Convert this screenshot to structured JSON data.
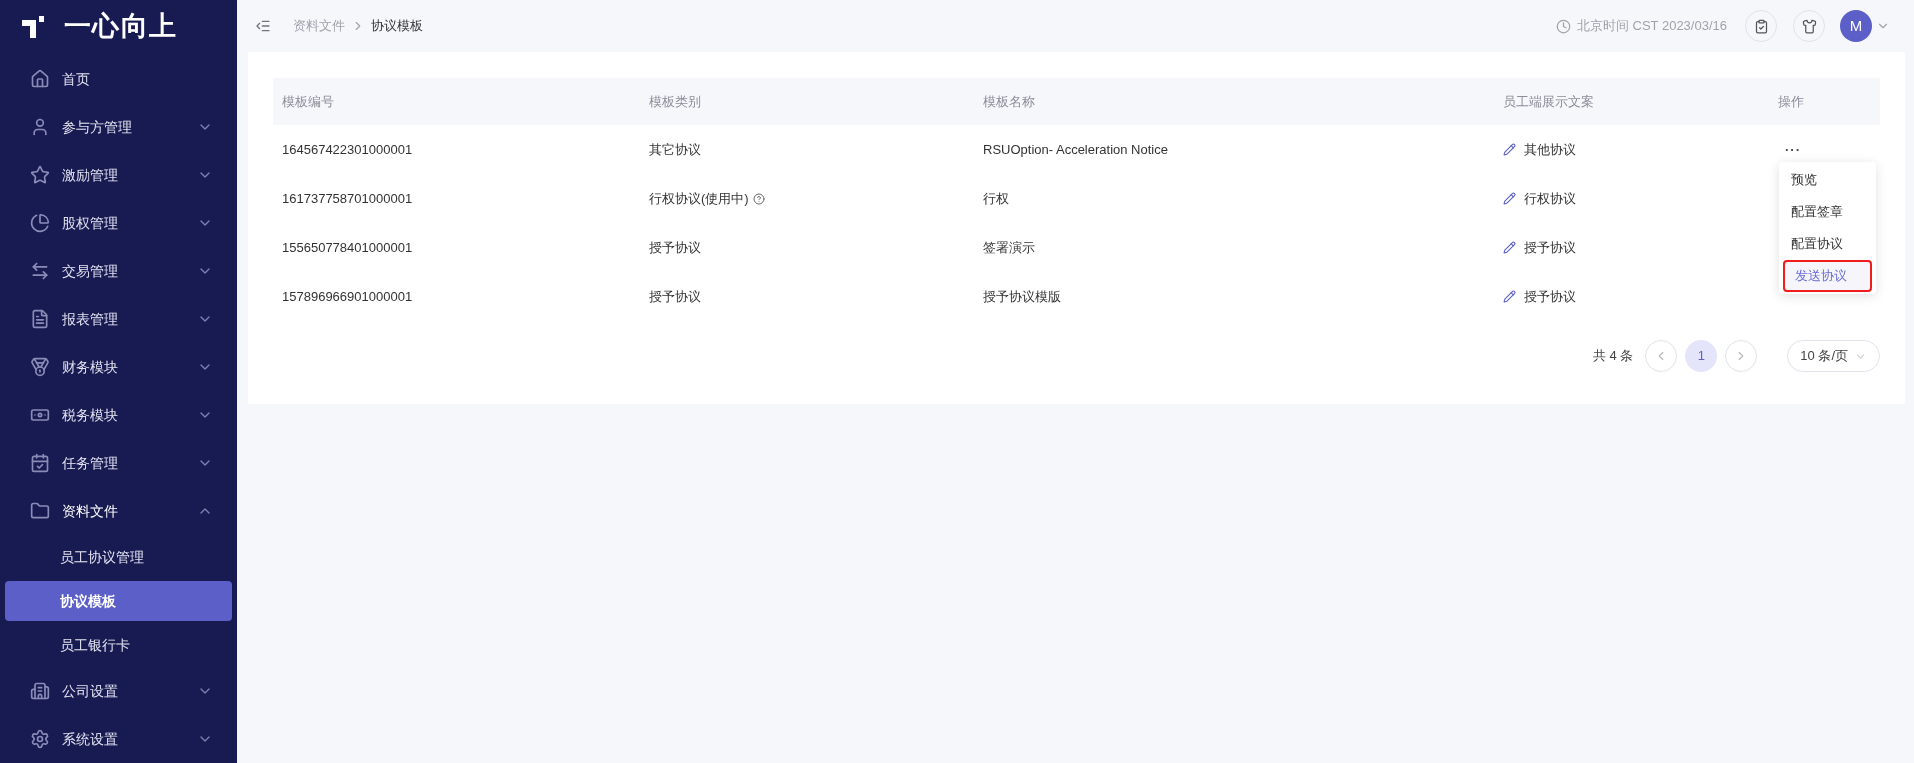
{
  "logo": {
    "text": "一心向上"
  },
  "sidebar": {
    "items": [
      {
        "label": "首页"
      },
      {
        "label": "参与方管理",
        "expanded": false
      },
      {
        "label": "激励管理",
        "expanded": false
      },
      {
        "label": "股权管理",
        "expanded": false
      },
      {
        "label": "交易管理",
        "expanded": false
      },
      {
        "label": "报表管理",
        "expanded": false
      },
      {
        "label": "财务模块",
        "expanded": false
      },
      {
        "label": "税务模块",
        "expanded": false
      },
      {
        "label": "任务管理",
        "expanded": false
      },
      {
        "label": "资料文件",
        "expanded": true,
        "children": [
          {
            "label": "员工协议管理",
            "selected": false
          },
          {
            "label": "协议模板",
            "selected": true
          },
          {
            "label": "员工银行卡",
            "selected": false
          }
        ]
      },
      {
        "label": "公司设置",
        "expanded": false
      },
      {
        "label": "系统设置",
        "expanded": false
      }
    ]
  },
  "header": {
    "breadcrumb": [
      "资料文件",
      "协议模板"
    ],
    "time": "北京时间 CST 2023/03/16",
    "avatar": "M"
  },
  "table": {
    "columns": [
      "模板编号",
      "模板类别",
      "模板名称",
      "员工端展示文案",
      "操作"
    ],
    "rows": [
      {
        "id": "164567422301000001",
        "category": "其它协议",
        "category_help": false,
        "name": "RSUOption- Acceleration Notice",
        "display": "其他协议",
        "actions": "···"
      },
      {
        "id": "161737758701000001",
        "category": "行权协议(使用中)",
        "category_help": true,
        "name": "行权",
        "display": "行权协议"
      },
      {
        "id": "155650778401000001",
        "category": "授予协议",
        "category_help": false,
        "name": "签署演示",
        "display": "授予协议"
      },
      {
        "id": "157896966901000001",
        "category": "授予协议",
        "category_help": false,
        "name": "授予协议模版",
        "display": "授予协议"
      }
    ]
  },
  "action_menu": {
    "items": [
      {
        "label": "预览",
        "highlighted": false
      },
      {
        "label": "配置签章",
        "highlighted": false
      },
      {
        "label": "配置协议",
        "highlighted": false
      },
      {
        "label": "发送协议",
        "highlighted": true
      }
    ]
  },
  "pagination": {
    "total": "共 4 条",
    "pages": [
      {
        "label": "1",
        "selected": true
      }
    ],
    "page_size": "10 条/页"
  }
}
